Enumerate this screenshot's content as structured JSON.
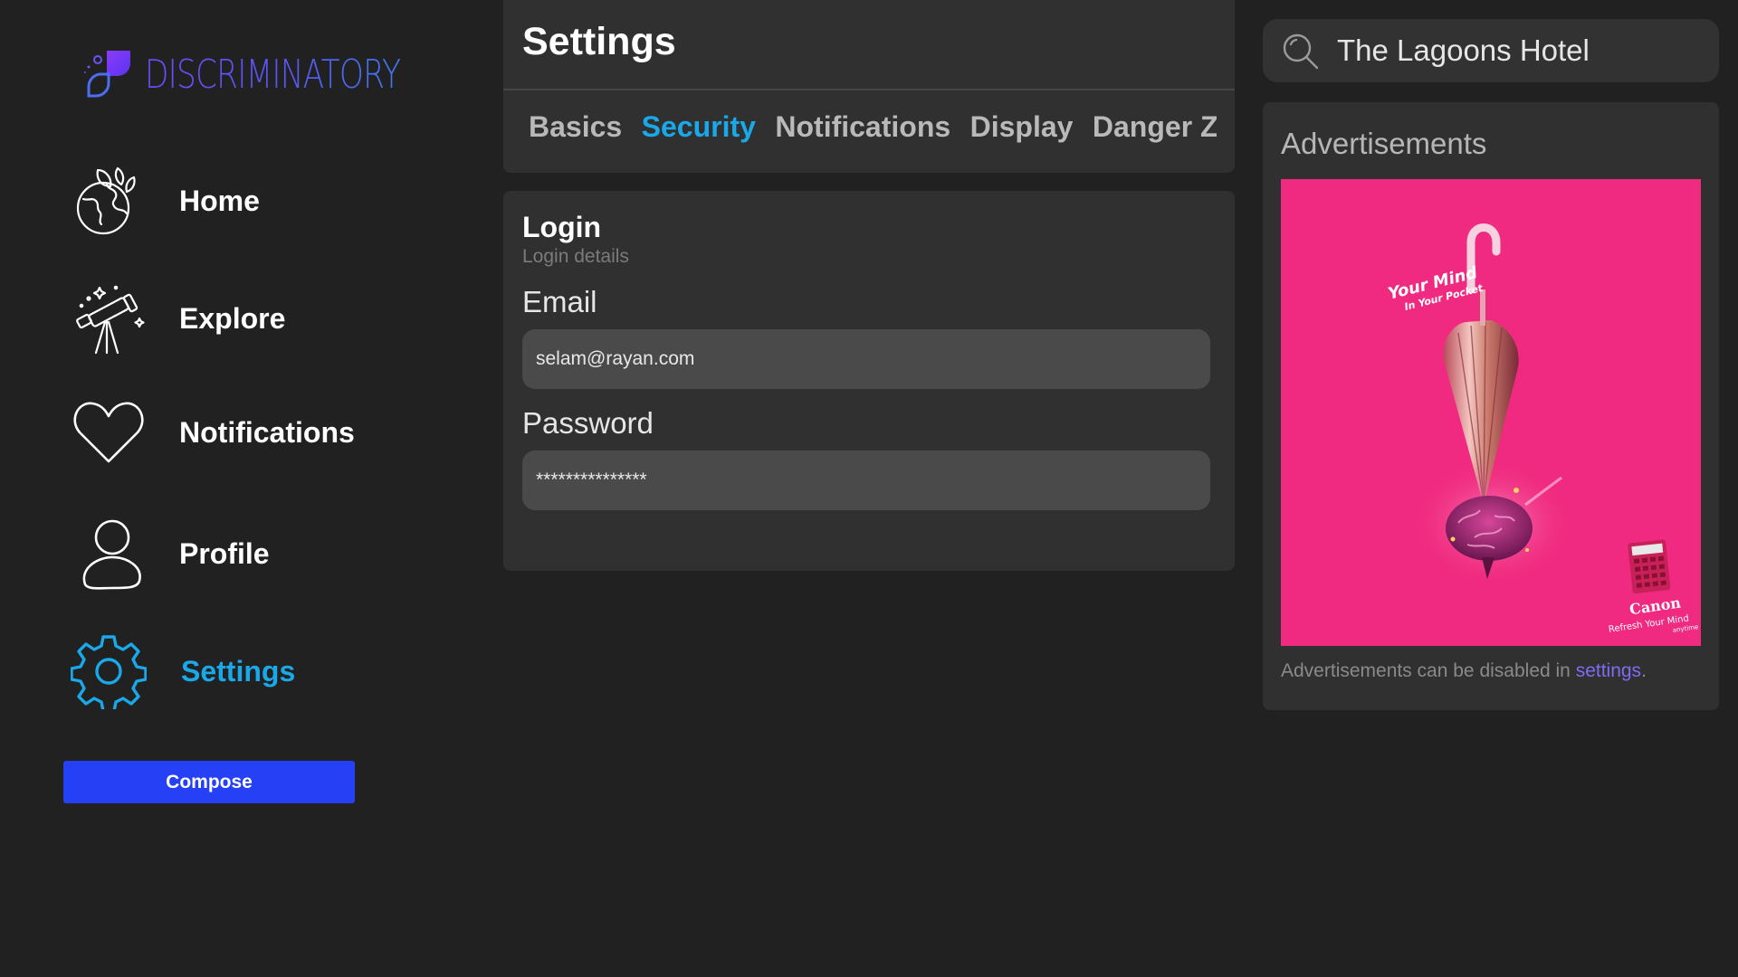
{
  "app": {
    "name": "DISCRIMINATORY",
    "colors": {
      "accent": "#1aa8e8",
      "compose": "#2641f5",
      "brand_start": "#6b4cf6",
      "brand_end": "#3f78f0",
      "ad_background": "#f02a80"
    }
  },
  "sidebar": {
    "items": [
      {
        "label": "Home",
        "icon": "globe-leaves-icon"
      },
      {
        "label": "Explore",
        "icon": "telescope-icon"
      },
      {
        "label": "Notifications",
        "icon": "heart-icon"
      },
      {
        "label": "Profile",
        "icon": "user-icon"
      },
      {
        "label": "Settings",
        "icon": "gear-icon",
        "active": true
      }
    ],
    "compose_label": "Compose"
  },
  "settings": {
    "title": "Settings",
    "tabs": [
      {
        "label": "Basics"
      },
      {
        "label": "Security",
        "active": true
      },
      {
        "label": "Notifications"
      },
      {
        "label": "Display"
      },
      {
        "label": "Danger Zone"
      }
    ]
  },
  "login": {
    "title": "Login",
    "subtitle": "Login details",
    "email_label": "Email",
    "email_value": "selam@rayan.com",
    "password_label": "Password",
    "password_value": "***************"
  },
  "search": {
    "value": "The Lagoons Hotel",
    "icon": "search-icon"
  },
  "ads": {
    "title": "Advertisements",
    "image": {
      "headline_1": "Your Mind",
      "headline_2": "In Your Pocket",
      "brand": "Canon",
      "tagline": "Refresh Your Mind",
      "tagline_2": "anytime"
    },
    "note_prefix": "Advertisements can be disabled in ",
    "note_link": "settings",
    "note_suffix": "."
  }
}
